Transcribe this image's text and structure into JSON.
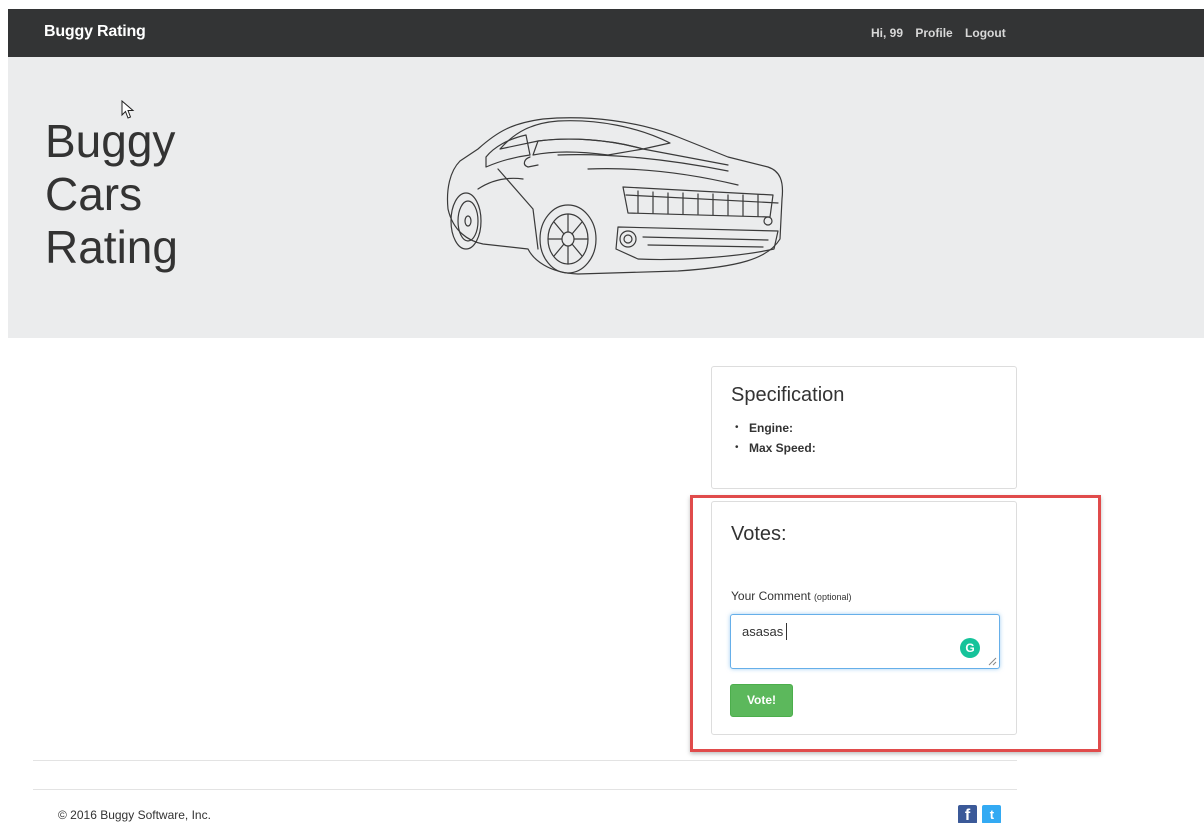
{
  "navbar": {
    "brand": "Buggy Rating",
    "greeting": "Hi, 99",
    "profile_link": "Profile",
    "logout_link": "Logout"
  },
  "hero": {
    "title_lines": [
      "Buggy",
      "Cars",
      "Rating"
    ],
    "car_image": "car-line-drawing"
  },
  "specification": {
    "title": "Specification",
    "items": [
      {
        "label": "Engine:"
      },
      {
        "label": "Max Speed:"
      }
    ]
  },
  "votes": {
    "title": "Votes:",
    "comment_label": "Your Comment",
    "comment_optional": "(optional)",
    "comment_value": "asasas",
    "grammarly_icon": "grammarly-icon",
    "vote_button": "Vote!"
  },
  "footer": {
    "copyright": "© 2016 Buggy Software, Inc.",
    "social": [
      "facebook-icon",
      "twitter-icon"
    ]
  },
  "colors": {
    "navbar_bg": "#333435",
    "hero_bg": "#ebeced",
    "vote_button": "#5cb85c",
    "highlight": "#e04b4b",
    "facebook": "#3b5998",
    "twitter": "#33aaf3"
  }
}
